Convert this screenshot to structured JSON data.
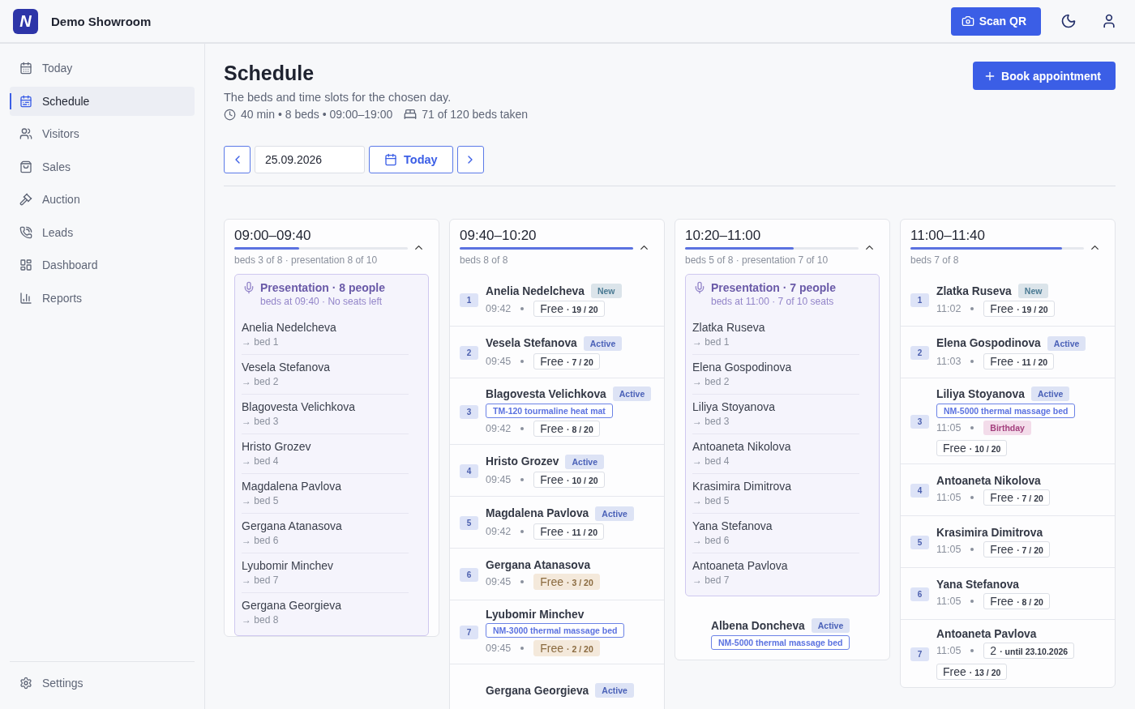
{
  "app": {
    "logo": "N",
    "title": "Demo Showroom"
  },
  "header_actions": {
    "scan_button": "Scan QR"
  },
  "sidebar": {
    "items": [
      {
        "label": "Today",
        "selected": false
      },
      {
        "label": "Schedule",
        "selected": true
      },
      {
        "label": "Visitors",
        "selected": false
      },
      {
        "label": "Sales",
        "selected": false
      },
      {
        "label": "Auction",
        "selected": false
      },
      {
        "label": "Leads",
        "selected": false
      },
      {
        "label": "Dashboard",
        "selected": false
      },
      {
        "label": "Reports",
        "selected": false
      }
    ],
    "footer_item": {
      "label": "Settings",
      "selected": false
    }
  },
  "page": {
    "title": "Schedule",
    "subtitle": "The beds and time slots for the chosen day.",
    "meta_duration": "40 min • 8 beds • 09:00–19:00",
    "meta_beds": "71 of 120 beds taken",
    "book_button": "Book appointment"
  },
  "date_nav": {
    "date": "25.09.2026",
    "today_button": "Today"
  },
  "slots": [
    {
      "time": "09:00–09:40",
      "level": 0.375,
      "summary": "beds 3 of 8 · presentation 8 of 10",
      "expanded": true,
      "presentation": {
        "title": "Presentation · 8 people",
        "subtitle": "beds at 09:40 · No seats left",
        "attendees": [
          {
            "name": "Anelia Nedelcheva",
            "bed": "→ bed 1"
          },
          {
            "name": "Vesela Stefanova",
            "bed": "→ bed 2"
          },
          {
            "name": "Blagovesta Velichkova",
            "bed": "→ bed 3"
          },
          {
            "name": "Hristo Grozev",
            "bed": "→ bed 4"
          },
          {
            "name": "Magdalena Pavlova",
            "bed": "→ bed 5"
          },
          {
            "name": "Gergana Atanasova",
            "bed": "→ bed 6"
          },
          {
            "name": "Lyubomir Minchev",
            "bed": "→ bed 7"
          },
          {
            "name": "Gergana Georgieva",
            "bed": "→ bed 8"
          }
        ]
      }
    },
    {
      "time": "09:40–10:20",
      "level": 1,
      "summary": "beds 8 of 8",
      "expanded": true,
      "bookings": [
        {
          "bed": "1",
          "name": "Anelia Nedelcheva",
          "status": {
            "label": "New",
            "kind": "new"
          },
          "time": "09:42",
          "passes": [
            {
              "label": "Free",
              "detail": "· 19 / 20",
              "low": false
            }
          ]
        },
        {
          "bed": "2",
          "name": "Vesela Stefanova",
          "status": {
            "label": "Active",
            "kind": "active"
          },
          "time": "09:45",
          "passes": [
            {
              "label": "Free",
              "detail": "· 7 / 20",
              "low": false
            }
          ]
        },
        {
          "bed": "3",
          "name": "Blagovesta Velichkova",
          "status": {
            "label": "Active",
            "kind": "active"
          },
          "device": "TM-120 tourmaline heat mat",
          "time": "09:42",
          "passes": [
            {
              "label": "Free",
              "detail": "· 8 / 20",
              "low": false
            }
          ]
        },
        {
          "bed": "4",
          "name": "Hristo Grozev",
          "status": {
            "label": "Active",
            "kind": "active"
          },
          "time": "09:45",
          "passes": [
            {
              "label": "Free",
              "detail": "· 10 / 20",
              "low": false
            }
          ]
        },
        {
          "bed": "5",
          "name": "Magdalena Pavlova",
          "status": {
            "label": "Active",
            "kind": "active"
          },
          "time": "09:42",
          "passes": [
            {
              "label": "Free",
              "detail": "· 11 / 20",
              "low": false
            }
          ]
        },
        {
          "bed": "6",
          "name": "Gergana Atanasova",
          "time": "09:45",
          "passes": [
            {
              "label": "Free",
              "detail": "· 3 / 20",
              "low": true
            }
          ]
        },
        {
          "bed": "7",
          "name": "Lyubomir Minchev",
          "device": "NM-3000 thermal massage bed",
          "time": "09:45",
          "passes": [
            {
              "label": "Free",
              "detail": "· 2 / 20",
              "low": true
            }
          ]
        },
        {
          "name": "Gergana Georgieva",
          "status": {
            "label": "Active",
            "kind": "active"
          }
        }
      ]
    },
    {
      "time": "10:20–11:00",
      "level": 0.625,
      "summary": "beds 5 of 8 · presentation 7 of 10",
      "expanded": true,
      "presentation": {
        "title": "Presentation · 7 people",
        "subtitle": "beds at 11:00 · 7 of 10 seats",
        "attendees": [
          {
            "name": "Zlatka Ruseva",
            "bed": "→ bed 1"
          },
          {
            "name": "Elena Gospodinova",
            "bed": "→ bed 2"
          },
          {
            "name": "Liliya Stoyanova",
            "bed": "→ bed 3"
          },
          {
            "name": "Antoaneta Nikolova",
            "bed": "→ bed 4"
          },
          {
            "name": "Krasimira Dimitrova",
            "bed": "→ bed 5"
          },
          {
            "name": "Yana Stefanova",
            "bed": "→ bed 6"
          },
          {
            "name": "Antoaneta Pavlova",
            "bed": "→ bed 7"
          }
        ]
      },
      "bookings": [
        {
          "name": "Albena Doncheva",
          "status": {
            "label": "Active",
            "kind": "active"
          },
          "device": "NM-5000 thermal massage bed"
        }
      ]
    },
    {
      "time": "11:00–11:40",
      "level": 0.875,
      "summary": "beds 7 of 8",
      "expanded": true,
      "bookings": [
        {
          "bed": "1",
          "name": "Zlatka Ruseva",
          "status": {
            "label": "New",
            "kind": "new"
          },
          "time": "11:02",
          "passes": [
            {
              "label": "Free",
              "detail": "· 19 / 20",
              "low": false
            }
          ]
        },
        {
          "bed": "2",
          "name": "Elena Gospodinova",
          "status": {
            "label": "Active",
            "kind": "active"
          },
          "time": "11:03",
          "passes": [
            {
              "label": "Free",
              "detail": "· 11 / 20",
              "low": false
            }
          ]
        },
        {
          "bed": "3",
          "name": "Liliya Stoyanova",
          "status": {
            "label": "Active",
            "kind": "active"
          },
          "device": "NM-5000 thermal massage bed",
          "time": "11:05",
          "tag": "Birthday",
          "passes": [
            {
              "label": "Free",
              "detail": "· 10 / 20",
              "low": false
            }
          ]
        },
        {
          "bed": "4",
          "name": "Antoaneta Nikolova",
          "time": "11:05",
          "passes": [
            {
              "label": "Free",
              "detail": "· 7 / 20",
              "low": false
            }
          ]
        },
        {
          "bed": "5",
          "name": "Krasimira Dimitrova",
          "time": "11:05",
          "passes": [
            {
              "label": "Free",
              "detail": "· 7 / 20",
              "low": false
            }
          ]
        },
        {
          "bed": "6",
          "name": "Yana Stefanova",
          "time": "11:05",
          "passes": [
            {
              "label": "Free",
              "detail": "· 8 / 20",
              "low": false
            }
          ]
        },
        {
          "bed": "7",
          "name": "Antoaneta Pavlova",
          "time": "11:05",
          "passes": [
            {
              "label": "2",
              "detail": "· until 23.10.2026",
              "low": false
            },
            {
              "label": "Free",
              "detail": "· 13 / 20",
              "low": false
            }
          ]
        }
      ]
    }
  ]
}
